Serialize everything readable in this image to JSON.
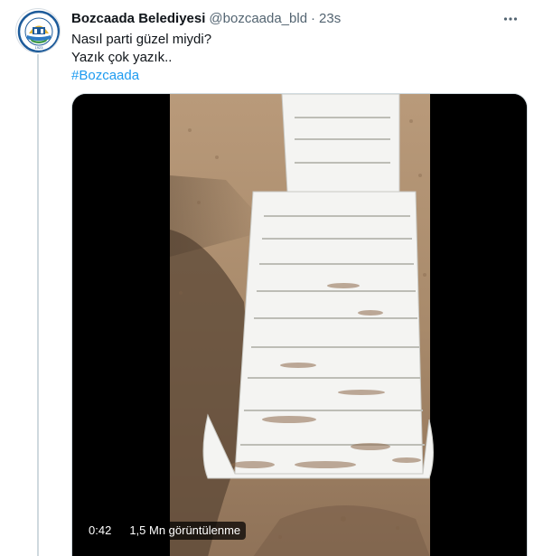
{
  "tweet": {
    "display_name": "Bozcaada Belediyesi",
    "handle": "@bozcaada_bld",
    "separator": "·",
    "time": "23s",
    "lines": [
      "Nasıl parti güzel miydi?",
      "Yazık çok yazık.."
    ],
    "hashtag": "#Bozcaada",
    "more_icon": "more-horizontal-icon"
  },
  "avatar": {
    "logo_text": "BOZCAADA BELEDİYESİ",
    "year": "1923",
    "colors": {
      "ring": "#1d5b9a",
      "gold": "#e0b43a",
      "blue": "#2e7bc4",
      "green": "#3e9a4a"
    }
  },
  "video": {
    "duration": "0:42",
    "views": "1,5 Mn görüntülenme"
  },
  "colors": {
    "accent": "#1d9bf0",
    "secondary_text": "#536471",
    "border": "#cfd9de"
  }
}
